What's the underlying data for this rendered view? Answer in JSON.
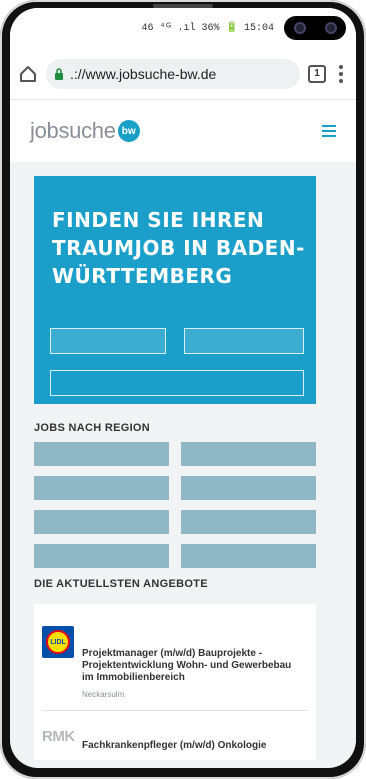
{
  "status": {
    "text": "46 ⁴ᴳ .ıl 36% 🔋 15:04"
  },
  "browser": {
    "url": ".://www.jobsuche-bw.de",
    "tabs_count": "1"
  },
  "site": {
    "logo_text": "jobsuche",
    "logo_badge": "bw",
    "logo_tagline": ""
  },
  "hero": {
    "title": "FINDEN SIE IHREN TRAUMJOB IN BADEN-WÜRTTEMBERG",
    "field1_placeholder": "",
    "field2_placeholder": "",
    "button_label": ""
  },
  "regions_title": "JOBS NACH REGION",
  "regions": [
    {
      "label": ""
    },
    {
      "label": ""
    },
    {
      "label": ""
    },
    {
      "label": ""
    },
    {
      "label": ""
    },
    {
      "label": ""
    },
    {
      "label": ""
    },
    {
      "label": ""
    }
  ],
  "offers_title": "DIE AKTUELLSTEN ANGEBOTE",
  "jobs": [
    {
      "company_logo": "LIDL",
      "meta": "",
      "title": "Projektmanager (m/w/d) Bauprojekte - Projektentwicklung Wohn- und Gewerbebau im Immobilienbereich",
      "location": "Neckarsulm"
    },
    {
      "company_logo": "RMK",
      "meta": "",
      "title": "Fachkrankenpfleger (m/w/d) Onkologie",
      "location": ""
    }
  ],
  "colors": {
    "brand": "#1b9ec9",
    "region_button": "#8fb7c6"
  }
}
